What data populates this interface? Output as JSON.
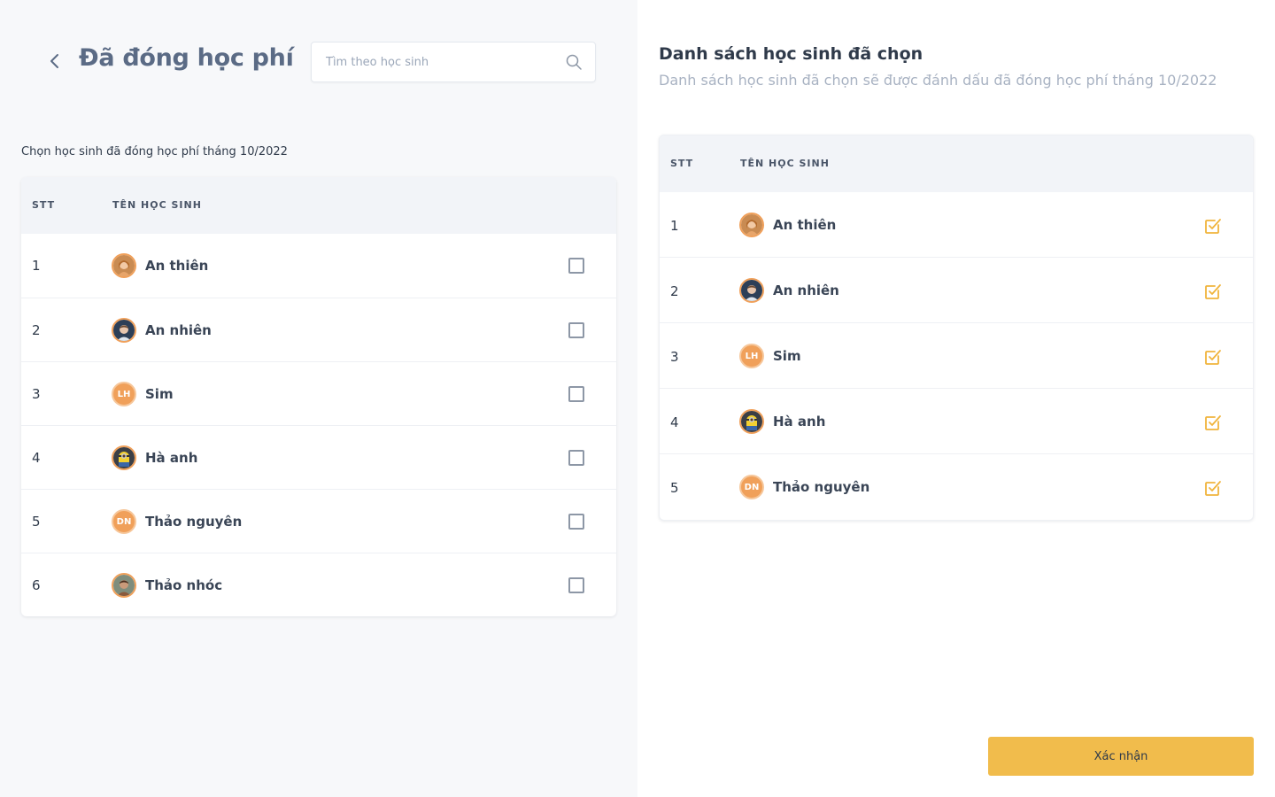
{
  "header": {
    "title": "Đã đóng học phí"
  },
  "search": {
    "placeholder": "Tìm theo học sinh"
  },
  "left": {
    "subtitle": "Chọn học sinh đã đóng học phí tháng 10/2022",
    "columns": {
      "stt": "STT",
      "name": "TÊN HỌC SINH"
    },
    "students": [
      {
        "stt": "1",
        "name": "An thiên",
        "avatar": "photo-girl",
        "checked": false
      },
      {
        "stt": "2",
        "name": "An nhiên",
        "avatar": "photo-boy",
        "checked": false
      },
      {
        "stt": "3",
        "name": "Sim",
        "avatar": "initials",
        "initials": "LH",
        "checked": false
      },
      {
        "stt": "4",
        "name": "Hà anh",
        "avatar": "photo-minion",
        "checked": false
      },
      {
        "stt": "5",
        "name": "Thảo nguyên",
        "avatar": "initials",
        "initials": "DN",
        "checked": false
      },
      {
        "stt": "6",
        "name": "Thảo nhóc",
        "avatar": "photo-man",
        "checked": false
      }
    ]
  },
  "right": {
    "title": "Danh sách học sinh đã chọn",
    "subtitle": "Danh sách học sinh đã chọn sẽ được đánh dấu đã đóng học phí tháng 10/2022",
    "columns": {
      "stt": "STT",
      "name": "TÊN HỌC SINH"
    },
    "students": [
      {
        "stt": "1",
        "name": "An thiên",
        "avatar": "photo-girl"
      },
      {
        "stt": "2",
        "name": "An nhiên",
        "avatar": "photo-boy"
      },
      {
        "stt": "3",
        "name": "Sim",
        "avatar": "initials",
        "initials": "LH"
      },
      {
        "stt": "4",
        "name": "Hà anh",
        "avatar": "photo-minion"
      },
      {
        "stt": "5",
        "name": "Thảo nguyên",
        "avatar": "initials",
        "initials": "DN"
      }
    ]
  },
  "footer": {
    "confirm_label": "Xác nhận"
  },
  "colors": {
    "accent": "#f1bc4c",
    "check_accent": "#f0b43c",
    "avatar_initials_bg": "#f0a05a",
    "title_color": "#5b6b85"
  }
}
